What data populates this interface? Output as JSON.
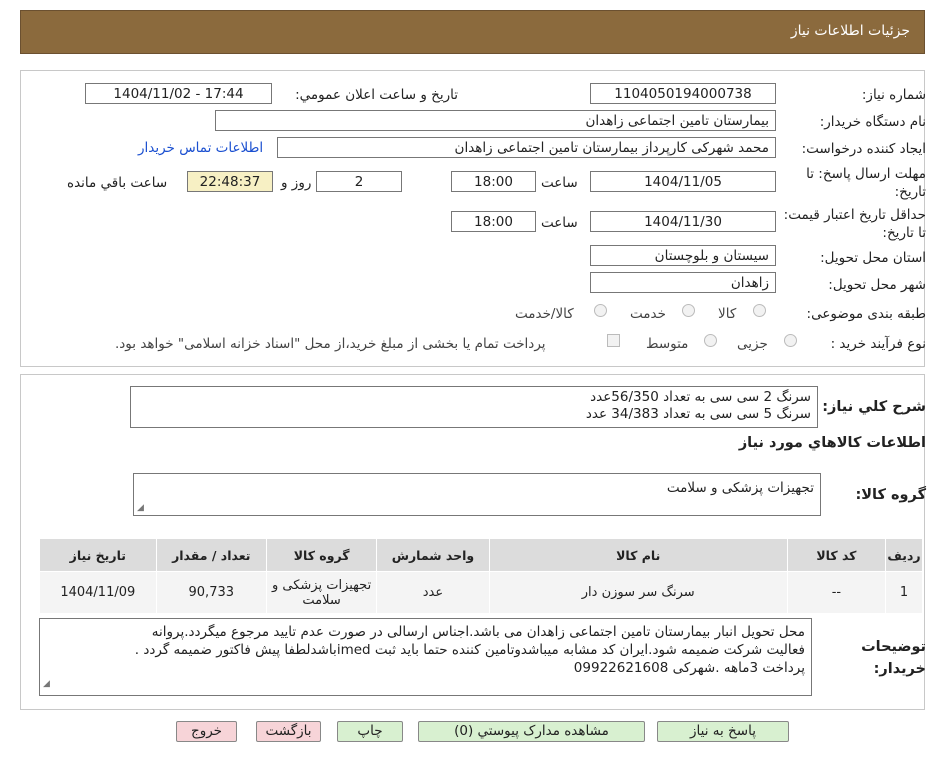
{
  "header": {
    "title": "جزئیات اطلاعات نیاز"
  },
  "form": {
    "need_number_label": "شماره نیاز:",
    "need_number": "1104050194000738",
    "announce_label": "تاریخ و ساعت اعلان عمومي:",
    "announce_value": "1404/11/02 - 17:44",
    "buyer_label": "نام دستگاه خريدار:",
    "buyer_value": "بیمارستان تامین اجتماعی زاهدان",
    "requester_label": "ايجاد کننده درخواست:",
    "requester_value": "محمد شهرکی کارپرداز بیمارستان تامین اجتماعی زاهدان",
    "contact_link": "اطلاعات تماس خريدار",
    "deadline_label": "مهلت ارسال پاسخ: تا تاريخ:",
    "deadline_date": "1404/11/05",
    "time_label": "ساعت",
    "deadline_time": "18:00",
    "days_value": "2",
    "days_label": "روز و",
    "remaining_time": "22:48:37",
    "remaining_label": "ساعت باقي مانده",
    "validity_label": "حداقل تاريخ اعتبار قيمت: تا تاريخ:",
    "validity_date": "1404/11/30",
    "validity_time": "18:00",
    "province_label": "استان محل تحويل:",
    "province_value": "سيستان و بلوچستان",
    "city_label": "شهر محل تحويل:",
    "city_value": "زاهدان",
    "category_label": "طبقه بندی موضوعی:",
    "category_options": [
      "کالا",
      "خدمت",
      "کالا/خدمت"
    ],
    "process_label": "نوع فرآیند خرید :",
    "process_options": [
      "جزیی",
      "متوسط"
    ],
    "payment_note": "پرداخت تمام یا بخشی از مبلغ خرید،از محل \"اسناد خزانه اسلامی\" خواهد بود."
  },
  "description": {
    "label": "شرح کلي نياز:",
    "line1": "سرنگ 2 سی سی به تعداد 56/350عدد",
    "line2": "سرنگ 5 سی سی به تعداد 34/383 عدد"
  },
  "goods_info": {
    "title": "اطلاعات کالاهاي مورد نياز",
    "group_label": "گروه کالا:",
    "group_value": "تجهیزات پزشکی و سلامت"
  },
  "table": {
    "headers": [
      "رديف",
      "کد کالا",
      "نام کالا",
      "واحد شمارش",
      "گروه کالا",
      "تعداد / مقدار",
      "تاريخ نياز"
    ],
    "rows": [
      {
        "row": "1",
        "code": "--",
        "name": "سرنگ سر سوزن دار",
        "unit": "عدد",
        "group": "تجهیزات پزشکی و سلامت",
        "qty": "90,733",
        "date": "1404/11/09"
      }
    ]
  },
  "buyer_notes": {
    "label": "توضيحات خريدار:",
    "line1": "محل تحویل انبار بیمارستان تامین اجتماعی زاهدان می باشد.اجناس ارسالی در صورت عدم تایید مرجوع میگردد.پروانه",
    "line2": "فعالیت شرکت ضمیمه شود.ایران کد مشابه میباشدوتامین کننده حتما باید ثبت imedباشدلطفا پیش فاکتور ضمیمه گردد .",
    "line3": "پرداخت 3ماهه  .شهرکی 09922621608"
  },
  "buttons": {
    "reply": "پاسخ به نياز",
    "attachments": "مشاهده مدارک پيوستي (0)",
    "print": "چاپ",
    "back": "بازگشت",
    "exit": "خروج"
  },
  "colors": {
    "header_bg": "#8b6a3d",
    "green_btn": "#d8f0d0",
    "pink_btn": "#f7d4d8",
    "remaining_bg": "#f7f0c4"
  }
}
